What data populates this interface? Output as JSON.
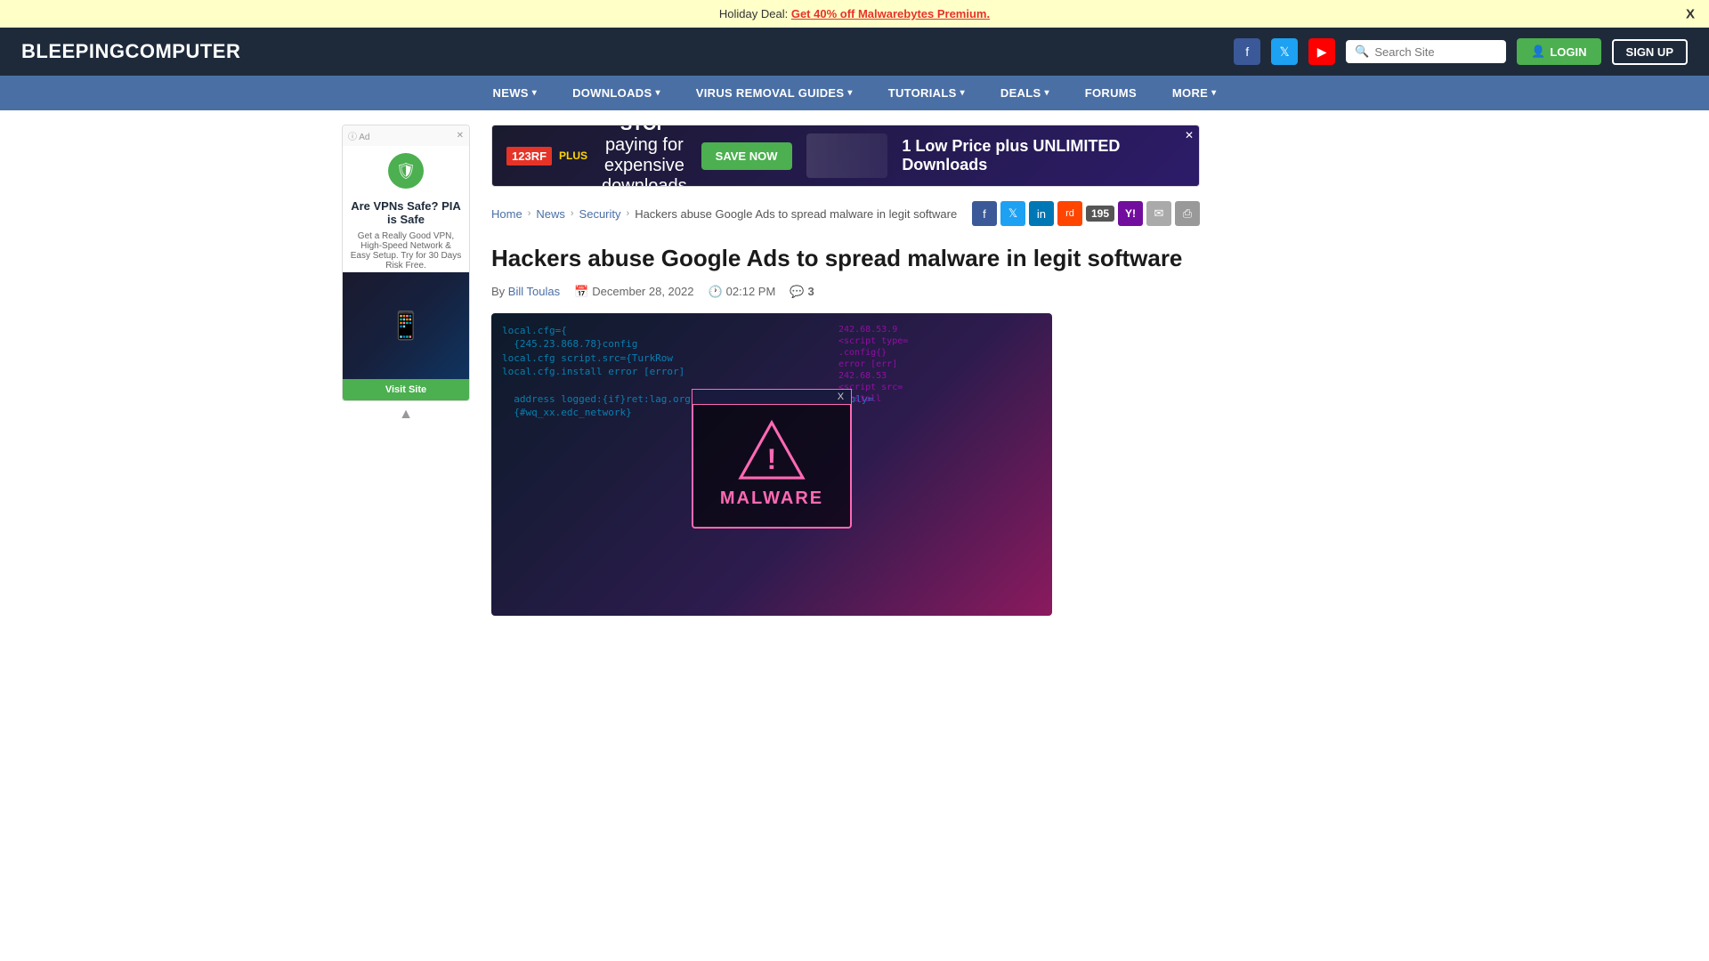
{
  "holiday_banner": {
    "text": "Holiday Deal: ",
    "link_text": "Get 40% off Malwarebytes Premium.",
    "link_url": "#",
    "close_label": "X"
  },
  "header": {
    "logo_part1": "BLEEPING",
    "logo_part2": "COMPUTER",
    "social": {
      "facebook_label": "f",
      "twitter_label": "t",
      "youtube_label": "▶"
    },
    "search_placeholder": "Search Site",
    "login_label": "LOGIN",
    "signup_label": "SIGN UP"
  },
  "nav": {
    "items": [
      {
        "label": "NEWS",
        "has_arrow": true
      },
      {
        "label": "DOWNLOADS",
        "has_arrow": true
      },
      {
        "label": "VIRUS REMOVAL GUIDES",
        "has_arrow": true
      },
      {
        "label": "TUTORIALS",
        "has_arrow": true
      },
      {
        "label": "DEALS",
        "has_arrow": true
      },
      {
        "label": "FORUMS",
        "has_arrow": false
      },
      {
        "label": "MORE",
        "has_arrow": true
      }
    ]
  },
  "left_ad": {
    "ad_label": "Ad",
    "close_label": "✕",
    "shield_icon": "🛡",
    "title": "Are VPNs Safe? PIA is Safe",
    "subtitle": "Get a Really Good VPN, High-Speed Network & Easy Setup. Try for 30 Days Risk Free.",
    "visit_label": "Visit Site",
    "scroll_up_label": "▲",
    "phone_icon": "📱"
  },
  "top_banner_ad": {
    "logo_text": "123RF",
    "plus_label": "PLUS",
    "headline": "STOP paying for expensive downloads",
    "save_label": "SAVE NOW",
    "right_text": "1 Low Price plus UNLIMITED Downloads",
    "close_label": "✕"
  },
  "breadcrumb": {
    "home": "Home",
    "news": "News",
    "security": "Security",
    "current": "Hackers abuse Google Ads to spread malware in legit software"
  },
  "share": {
    "count": "195",
    "yahoo_label": "Y!",
    "facebook_icon": "f",
    "twitter_icon": "t",
    "linkedin_icon": "in",
    "reddit_icon": "r",
    "email_icon": "✉",
    "print_icon": "🖨"
  },
  "article": {
    "title": "Hackers abuse Google Ads to spread malware in legit software",
    "author_prefix": "By",
    "author_name": "Bill Toulas",
    "date": "December 28, 2022",
    "time": "02:12 PM",
    "comments_count": "3",
    "date_icon": "📅",
    "time_icon": "🕐",
    "comments_icon": "💬"
  },
  "article_image": {
    "code_lines": [
      "local.cfg={",
      "  {245.23.868.78}config",
      "local.cfg script.src={TurkRow",
      "local.cfg.install error [error]"
    ],
    "malware_label": "MALWARE",
    "window_title": "X",
    "warning_symbol": "!"
  }
}
